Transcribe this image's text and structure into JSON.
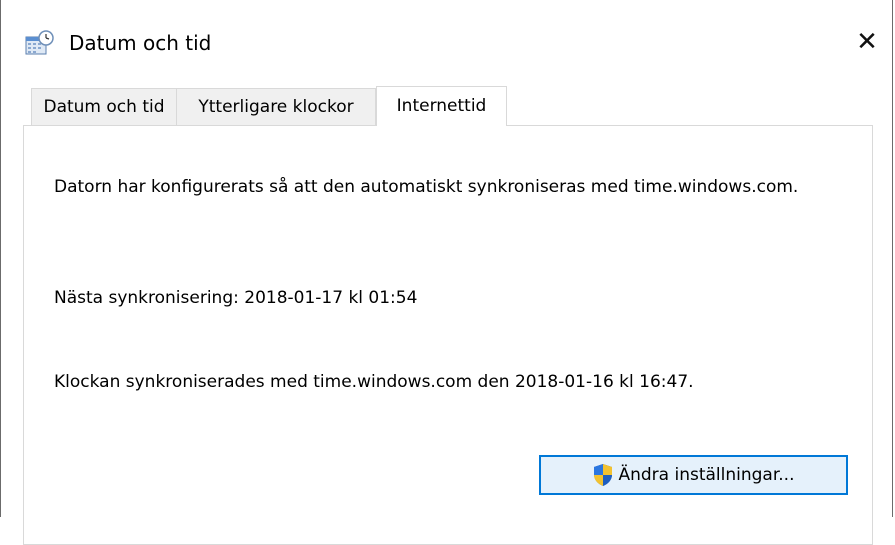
{
  "window": {
    "title": "Datum och tid",
    "close_glyph": "✕",
    "icon": "clock-calendar-icon"
  },
  "tabs": [
    {
      "label": "Datum och tid",
      "selected": false
    },
    {
      "label": "Ytterligare klockor",
      "selected": false
    },
    {
      "label": "Internettid",
      "selected": true
    }
  ],
  "panel": {
    "description": "Datorn har konfigurerats så att den automatiskt synkroniseras med time.windows.com.",
    "next_sync": "Nästa synkronisering: 2018-01-17 kl 01:54",
    "last_sync": "Klockan synkroniserades med time.windows.com den 2018-01-16 kl 16:47."
  },
  "buttons": {
    "change_settings_label": "Ändra inställningar...",
    "change_settings_icon": "uac-shield-icon"
  },
  "colors": {
    "button_border": "#0078d7",
    "button_bg": "#e5f1fb",
    "tab_bg": "#f0f0f0"
  }
}
